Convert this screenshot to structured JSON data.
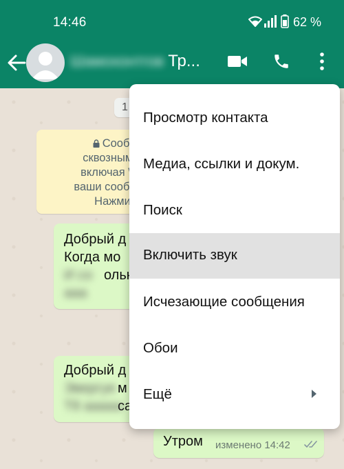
{
  "status_bar": {
    "time": "14:46",
    "battery_text": "62 %"
  },
  "app_bar": {
    "contact_name_blurred": "Шамохонтгов",
    "contact_name_suffix": "Тр..."
  },
  "chat": {
    "date_chip": "1",
    "encryption_notice": {
      "lines": [
        "Сообще",
        "сквозным ш",
        "включая Wh",
        "ваши сообще",
        "Нажмите,"
      ]
    },
    "messages": [
      {
        "lines": [
          "Добрый д",
          "Когда мо",
          "ольк",
          ""
        ],
        "blurred": [
          "И со",
          "ааа"
        ]
      },
      {
        "lines": [
          "Добрый д",
          "м",
          "са"
        ],
        "blurred": [
          "Эвергуе",
          "Т8 ааааа"
        ]
      }
    ],
    "last_message": {
      "text": "Утром",
      "meta": "изменено 14:42"
    }
  },
  "menu": {
    "items": [
      {
        "label": "Просмотр контакта"
      },
      {
        "label": "Медиа, ссылки и докум."
      },
      {
        "label": "Поиск"
      },
      {
        "label": "Включить звук"
      },
      {
        "label": "Исчезающие сообщения"
      },
      {
        "label": "Обои"
      },
      {
        "label": "Ещё"
      }
    ],
    "highlighted_index": 3
  },
  "colors": {
    "header": "#0b8466",
    "chat_background": "#e9e1d7",
    "outgoing_bubble": "#dcf8c6",
    "notice_bubble": "#fdf4c6",
    "menu_highlight": "#e1e1e1",
    "read_ticks": "#8696a0"
  },
  "icons": {
    "back": "arrow-left-icon",
    "video": "video-camera-icon",
    "call": "phone-icon",
    "more": "more-vertical-icon",
    "wifi": "wifi-icon",
    "signal": "signal-bars-icon",
    "battery": "battery-icon",
    "ticks": "double-check-icon",
    "submenu": "chevron-right-icon",
    "lock": "lock-icon"
  }
}
